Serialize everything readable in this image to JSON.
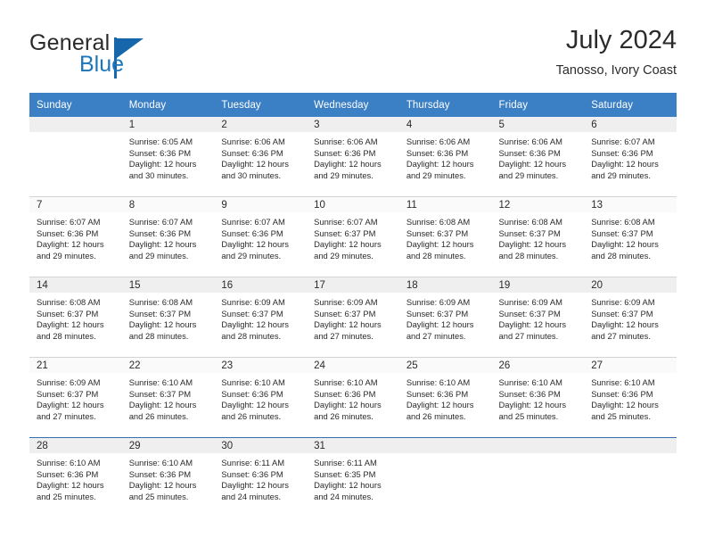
{
  "branding": {
    "name_part1": "General",
    "name_part2": "Blue",
    "logo_icon": "triangle-logo-icon"
  },
  "header": {
    "title": "July 2024",
    "subtitle": "Tanosso, Ivory Coast"
  },
  "calendar": {
    "weekday_headers": [
      "Sunday",
      "Monday",
      "Tuesday",
      "Wednesday",
      "Thursday",
      "Friday",
      "Saturday"
    ],
    "accent_color": "#3b7fc4",
    "band_color": "#efefef",
    "weeks": [
      [
        {
          "day": "",
          "empty": true,
          "sunrise": "",
          "sunset": "",
          "daylight1": "",
          "daylight2": ""
        },
        {
          "day": "1",
          "sunrise": "Sunrise: 6:05 AM",
          "sunset": "Sunset: 6:36 PM",
          "daylight1": "Daylight: 12 hours",
          "daylight2": "and 30 minutes."
        },
        {
          "day": "2",
          "sunrise": "Sunrise: 6:06 AM",
          "sunset": "Sunset: 6:36 PM",
          "daylight1": "Daylight: 12 hours",
          "daylight2": "and 30 minutes."
        },
        {
          "day": "3",
          "sunrise": "Sunrise: 6:06 AM",
          "sunset": "Sunset: 6:36 PM",
          "daylight1": "Daylight: 12 hours",
          "daylight2": "and 29 minutes."
        },
        {
          "day": "4",
          "sunrise": "Sunrise: 6:06 AM",
          "sunset": "Sunset: 6:36 PM",
          "daylight1": "Daylight: 12 hours",
          "daylight2": "and 29 minutes."
        },
        {
          "day": "5",
          "sunrise": "Sunrise: 6:06 AM",
          "sunset": "Sunset: 6:36 PM",
          "daylight1": "Daylight: 12 hours",
          "daylight2": "and 29 minutes."
        },
        {
          "day": "6",
          "sunrise": "Sunrise: 6:07 AM",
          "sunset": "Sunset: 6:36 PM",
          "daylight1": "Daylight: 12 hours",
          "daylight2": "and 29 minutes."
        }
      ],
      [
        {
          "day": "7",
          "sunrise": "Sunrise: 6:07 AM",
          "sunset": "Sunset: 6:36 PM",
          "daylight1": "Daylight: 12 hours",
          "daylight2": "and 29 minutes."
        },
        {
          "day": "8",
          "sunrise": "Sunrise: 6:07 AM",
          "sunset": "Sunset: 6:36 PM",
          "daylight1": "Daylight: 12 hours",
          "daylight2": "and 29 minutes."
        },
        {
          "day": "9",
          "sunrise": "Sunrise: 6:07 AM",
          "sunset": "Sunset: 6:36 PM",
          "daylight1": "Daylight: 12 hours",
          "daylight2": "and 29 minutes."
        },
        {
          "day": "10",
          "sunrise": "Sunrise: 6:07 AM",
          "sunset": "Sunset: 6:37 PM",
          "daylight1": "Daylight: 12 hours",
          "daylight2": "and 29 minutes."
        },
        {
          "day": "11",
          "sunrise": "Sunrise: 6:08 AM",
          "sunset": "Sunset: 6:37 PM",
          "daylight1": "Daylight: 12 hours",
          "daylight2": "and 28 minutes."
        },
        {
          "day": "12",
          "sunrise": "Sunrise: 6:08 AM",
          "sunset": "Sunset: 6:37 PM",
          "daylight1": "Daylight: 12 hours",
          "daylight2": "and 28 minutes."
        },
        {
          "day": "13",
          "sunrise": "Sunrise: 6:08 AM",
          "sunset": "Sunset: 6:37 PM",
          "daylight1": "Daylight: 12 hours",
          "daylight2": "and 28 minutes."
        }
      ],
      [
        {
          "day": "14",
          "sunrise": "Sunrise: 6:08 AM",
          "sunset": "Sunset: 6:37 PM",
          "daylight1": "Daylight: 12 hours",
          "daylight2": "and 28 minutes."
        },
        {
          "day": "15",
          "sunrise": "Sunrise: 6:08 AM",
          "sunset": "Sunset: 6:37 PM",
          "daylight1": "Daylight: 12 hours",
          "daylight2": "and 28 minutes."
        },
        {
          "day": "16",
          "sunrise": "Sunrise: 6:09 AM",
          "sunset": "Sunset: 6:37 PM",
          "daylight1": "Daylight: 12 hours",
          "daylight2": "and 28 minutes."
        },
        {
          "day": "17",
          "sunrise": "Sunrise: 6:09 AM",
          "sunset": "Sunset: 6:37 PM",
          "daylight1": "Daylight: 12 hours",
          "daylight2": "and 27 minutes."
        },
        {
          "day": "18",
          "sunrise": "Sunrise: 6:09 AM",
          "sunset": "Sunset: 6:37 PM",
          "daylight1": "Daylight: 12 hours",
          "daylight2": "and 27 minutes."
        },
        {
          "day": "19",
          "sunrise": "Sunrise: 6:09 AM",
          "sunset": "Sunset: 6:37 PM",
          "daylight1": "Daylight: 12 hours",
          "daylight2": "and 27 minutes."
        },
        {
          "day": "20",
          "sunrise": "Sunrise: 6:09 AM",
          "sunset": "Sunset: 6:37 PM",
          "daylight1": "Daylight: 12 hours",
          "daylight2": "and 27 minutes."
        }
      ],
      [
        {
          "day": "21",
          "sunrise": "Sunrise: 6:09 AM",
          "sunset": "Sunset: 6:37 PM",
          "daylight1": "Daylight: 12 hours",
          "daylight2": "and 27 minutes."
        },
        {
          "day": "22",
          "sunrise": "Sunrise: 6:10 AM",
          "sunset": "Sunset: 6:37 PM",
          "daylight1": "Daylight: 12 hours",
          "daylight2": "and 26 minutes."
        },
        {
          "day": "23",
          "sunrise": "Sunrise: 6:10 AM",
          "sunset": "Sunset: 6:36 PM",
          "daylight1": "Daylight: 12 hours",
          "daylight2": "and 26 minutes."
        },
        {
          "day": "24",
          "sunrise": "Sunrise: 6:10 AM",
          "sunset": "Sunset: 6:36 PM",
          "daylight1": "Daylight: 12 hours",
          "daylight2": "and 26 minutes."
        },
        {
          "day": "25",
          "sunrise": "Sunrise: 6:10 AM",
          "sunset": "Sunset: 6:36 PM",
          "daylight1": "Daylight: 12 hours",
          "daylight2": "and 26 minutes."
        },
        {
          "day": "26",
          "sunrise": "Sunrise: 6:10 AM",
          "sunset": "Sunset: 6:36 PM",
          "daylight1": "Daylight: 12 hours",
          "daylight2": "and 25 minutes."
        },
        {
          "day": "27",
          "sunrise": "Sunrise: 6:10 AM",
          "sunset": "Sunset: 6:36 PM",
          "daylight1": "Daylight: 12 hours",
          "daylight2": "and 25 minutes."
        }
      ],
      [
        {
          "day": "28",
          "sunrise": "Sunrise: 6:10 AM",
          "sunset": "Sunset: 6:36 PM",
          "daylight1": "Daylight: 12 hours",
          "daylight2": "and 25 minutes."
        },
        {
          "day": "29",
          "sunrise": "Sunrise: 6:10 AM",
          "sunset": "Sunset: 6:36 PM",
          "daylight1": "Daylight: 12 hours",
          "daylight2": "and 25 minutes."
        },
        {
          "day": "30",
          "sunrise": "Sunrise: 6:11 AM",
          "sunset": "Sunset: 6:36 PM",
          "daylight1": "Daylight: 12 hours",
          "daylight2": "and 24 minutes."
        },
        {
          "day": "31",
          "sunrise": "Sunrise: 6:11 AM",
          "sunset": "Sunset: 6:35 PM",
          "daylight1": "Daylight: 12 hours",
          "daylight2": "and 24 minutes."
        },
        {
          "day": "",
          "empty": true,
          "sunrise": "",
          "sunset": "",
          "daylight1": "",
          "daylight2": ""
        },
        {
          "day": "",
          "empty": true,
          "sunrise": "",
          "sunset": "",
          "daylight1": "",
          "daylight2": ""
        },
        {
          "day": "",
          "empty": true,
          "sunrise": "",
          "sunset": "",
          "daylight1": "",
          "daylight2": ""
        }
      ]
    ]
  }
}
